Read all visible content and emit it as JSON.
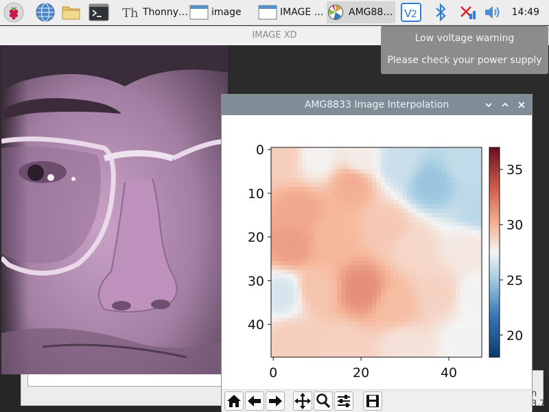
{
  "taskbar": {
    "tasks": [
      {
        "label": "Thonny…",
        "active": false
      },
      {
        "label": "image",
        "active": false
      },
      {
        "label": "IMAGE …",
        "active": false
      },
      {
        "label": "AMG88…",
        "active": true
      }
    ],
    "tray_icons": [
      "vnc-icon",
      "bluetooth-icon",
      "network-disconnected-icon",
      "volume-icon"
    ],
    "clock": "14:49",
    "launcher_icons": [
      "raspberry-menu-icon",
      "web-browser-icon",
      "file-manager-icon",
      "terminal-icon"
    ]
  },
  "background_window": {
    "title": "IMAGE XD",
    "truncated_text": "n 3.7"
  },
  "notification": {
    "line1": "Low voltage warning",
    "line2": "Please check your power supply"
  },
  "plot_window": {
    "title": "AMG8833 Image Interpolation",
    "controls": [
      "minimize-icon",
      "maximize-icon",
      "close-icon"
    ],
    "toolbar_icons": [
      "home-icon",
      "back-arrow-icon",
      "forward-arrow-icon",
      "pan-icon",
      "zoom-icon",
      "configure-subplots-icon",
      "save-icon"
    ]
  },
  "chart_data": {
    "type": "heatmap",
    "colormap": "RdBu_r",
    "x_ticks": [
      0,
      20,
      40
    ],
    "y_ticks": [
      0,
      10,
      20,
      30,
      40
    ],
    "x_range": [
      0,
      47
    ],
    "y_range": [
      0,
      47
    ],
    "y_inverted": true,
    "colorbar": {
      "ticks": [
        20,
        25,
        30,
        35
      ],
      "range": [
        18,
        37
      ]
    },
    "grid_size": 48,
    "anchor_points": [
      {
        "x": 2,
        "y": 2,
        "value": 29.0
      },
      {
        "x": 10,
        "y": 2,
        "value": 27.6
      },
      {
        "x": 20,
        "y": 2,
        "value": 27.8
      },
      {
        "x": 28,
        "y": 3,
        "value": 26.2
      },
      {
        "x": 36,
        "y": 8,
        "value": 24.8
      },
      {
        "x": 44,
        "y": 3,
        "value": 26.0
      },
      {
        "x": 46,
        "y": 14,
        "value": 25.8
      },
      {
        "x": 18,
        "y": 8,
        "value": 30.2
      },
      {
        "x": 6,
        "y": 14,
        "value": 30.4
      },
      {
        "x": 4,
        "y": 22,
        "value": 30.8
      },
      {
        "x": 14,
        "y": 20,
        "value": 29.8
      },
      {
        "x": 26,
        "y": 18,
        "value": 29.2
      },
      {
        "x": 32,
        "y": 22,
        "value": 28.6
      },
      {
        "x": 44,
        "y": 22,
        "value": 28.0
      },
      {
        "x": 2,
        "y": 33,
        "value": 26.6
      },
      {
        "x": 10,
        "y": 32,
        "value": 29.4
      },
      {
        "x": 20,
        "y": 32,
        "value": 31.4
      },
      {
        "x": 28,
        "y": 36,
        "value": 29.6
      },
      {
        "x": 38,
        "y": 33,
        "value": 28.8
      },
      {
        "x": 46,
        "y": 34,
        "value": 27.4
      },
      {
        "x": 4,
        "y": 44,
        "value": 29.0
      },
      {
        "x": 16,
        "y": 45,
        "value": 28.8
      },
      {
        "x": 30,
        "y": 45,
        "value": 28.2
      },
      {
        "x": 44,
        "y": 44,
        "value": 27.4
      }
    ]
  }
}
